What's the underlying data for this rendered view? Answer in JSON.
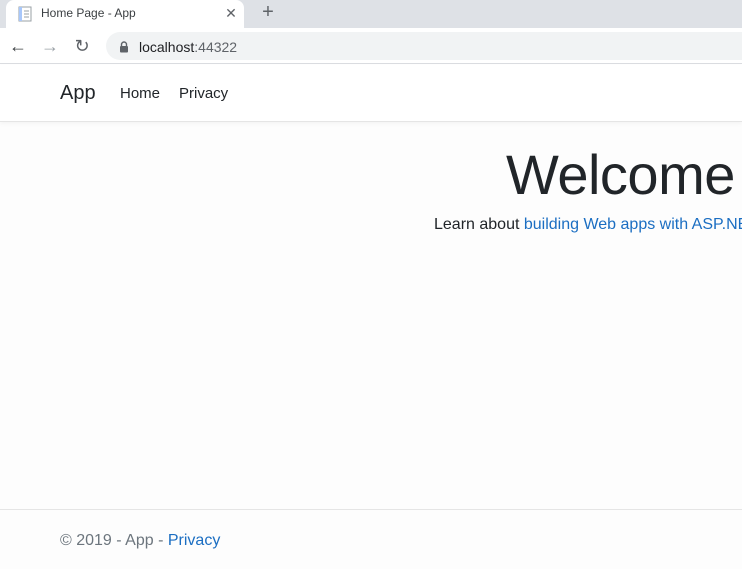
{
  "browser": {
    "tab": {
      "title": "Home Page - App",
      "close": "✕"
    },
    "new_tab": "+",
    "nav": {
      "back": "←",
      "forward": "→",
      "reload": "↻"
    },
    "url": {
      "host": "localhost",
      "port": ":44322"
    }
  },
  "navbar": {
    "brand": "App",
    "links": [
      {
        "label": "Home"
      },
      {
        "label": "Privacy"
      }
    ]
  },
  "hero": {
    "title": "Welcome",
    "text_prefix": "Learn about ",
    "link_text": "building Web apps with ASP.NE"
  },
  "footer": {
    "text_prefix": "© 2019 - App - ",
    "link_text": "Privacy"
  },
  "colors": {
    "link": "#1b6ec2",
    "tabstrip": "#dee1e6",
    "text": "#212529",
    "muted": "#6c757d"
  },
  "icons": {
    "favicon": "document-icon",
    "lock": "lock-icon"
  }
}
